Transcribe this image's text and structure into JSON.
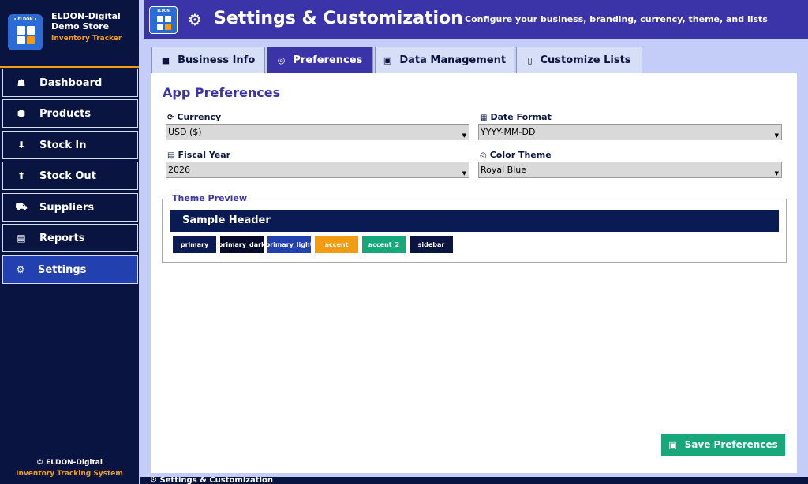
{
  "brand": {
    "logo_label": "• ELDON •",
    "name_line1": "ELDON-Digital",
    "name_line2": "Demo Store",
    "subtitle": "Inventory Tracker"
  },
  "sidebar": {
    "items": [
      {
        "label": "Dashboard",
        "icon": "home-icon",
        "glyph": "☗"
      },
      {
        "label": "Products",
        "icon": "box-icon",
        "glyph": "⬢"
      },
      {
        "label": "Stock In",
        "icon": "inbound-icon",
        "glyph": "⬇"
      },
      {
        "label": "Stock Out",
        "icon": "outbound-icon",
        "glyph": "⬆"
      },
      {
        "label": "Suppliers",
        "icon": "truck-icon",
        "glyph": "⛟"
      },
      {
        "label": "Reports",
        "icon": "report-icon",
        "glyph": "▤"
      },
      {
        "label": "Settings",
        "icon": "gear-icon",
        "glyph": "⚙"
      }
    ],
    "active": "Settings",
    "footer_line1": "© ELDON-Digital",
    "footer_line2": "Inventory Tracking System"
  },
  "header": {
    "logo_label": "ELDON",
    "gear_glyph": "⚙",
    "title": "Settings & Customization",
    "subtitle": "Configure your business, branding, currency, theme, and lists"
  },
  "tabs": [
    {
      "label": "Business Info",
      "glyph": "■"
    },
    {
      "label": "Preferences",
      "glyph": "◎"
    },
    {
      "label": "Data Management",
      "glyph": "▣"
    },
    {
      "label": "Customize Lists",
      "glyph": "▯"
    }
  ],
  "active_tab": "Preferences",
  "preferences": {
    "section_title": "App Preferences",
    "currency": {
      "label": "Currency",
      "glyph": "⟳",
      "value": "USD  ($)"
    },
    "date_format": {
      "label": "Date Format",
      "glyph": "▦",
      "value": "YYYY-MM-DD"
    },
    "fiscal_year": {
      "label": "Fiscal Year",
      "glyph": "▤",
      "value": "2026"
    },
    "color_theme": {
      "label": "Color Theme",
      "glyph": "◎",
      "value": "Royal Blue"
    },
    "dropdown_arrow": "▼"
  },
  "theme_preview": {
    "legend": "Theme Preview",
    "sample_header": "Sample Header",
    "swatches": [
      {
        "name": "primary",
        "color": "#0a1a52"
      },
      {
        "name": "primary_dark",
        "color": "#050a2a"
      },
      {
        "name": "primary_light",
        "color": "#2340b0"
      },
      {
        "name": "accent",
        "color": "#f39c12"
      },
      {
        "name": "accent_2",
        "color": "#16a879"
      },
      {
        "name": "sidebar",
        "color": "#0a1440"
      }
    ]
  },
  "save_button": {
    "label": "Save Preferences",
    "glyph": "▣"
  },
  "bottom_strip_text": "⚙  Settings & Customization",
  "colors": {
    "sidebar_bg": "#0a1440",
    "header_bg": "#3a34a8",
    "accent": "#f39c12",
    "success": "#16a879",
    "active_nav": "#2340b0"
  }
}
